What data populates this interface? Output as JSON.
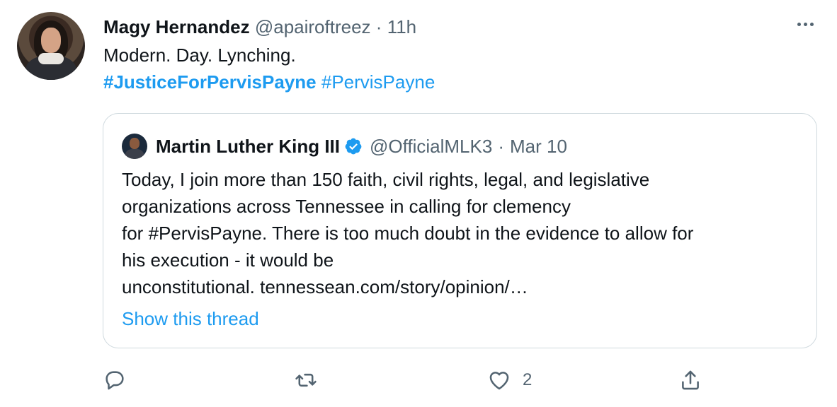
{
  "tweet": {
    "author_name": "Magy Hernandez",
    "author_handle": "@apairoftreez",
    "separator": "·",
    "time": "11h",
    "text_line1": "Modern. Day. Lynching.",
    "hashtag1": "#JusticeForPervisPayne",
    "hashtag2": "#PervisPayne"
  },
  "quoted_tweet": {
    "author_name": "Martin Luther King III",
    "author_handle": "@OfficialMLK3",
    "separator": "·",
    "date": "Mar 10",
    "lines": [
      "Today, I join more than 150 faith, civil rights, legal, and legislative",
      "organizations across Tennessee in calling for clemency",
      "for #PervisPayne. There is too much doubt in the evidence to allow for",
      "his execution - it would be",
      "unconstitutional. tennessean.com/story/opinion/…"
    ],
    "show_thread": "Show this thread"
  },
  "actions": {
    "like_count": "2"
  },
  "colors": {
    "accent": "#1d9bf0",
    "secondary_text": "#536471",
    "border": "#cfd9de"
  },
  "icons": [
    "more-icon",
    "verified-icon",
    "reply-icon",
    "retweet-icon",
    "like-icon",
    "share-icon"
  ]
}
